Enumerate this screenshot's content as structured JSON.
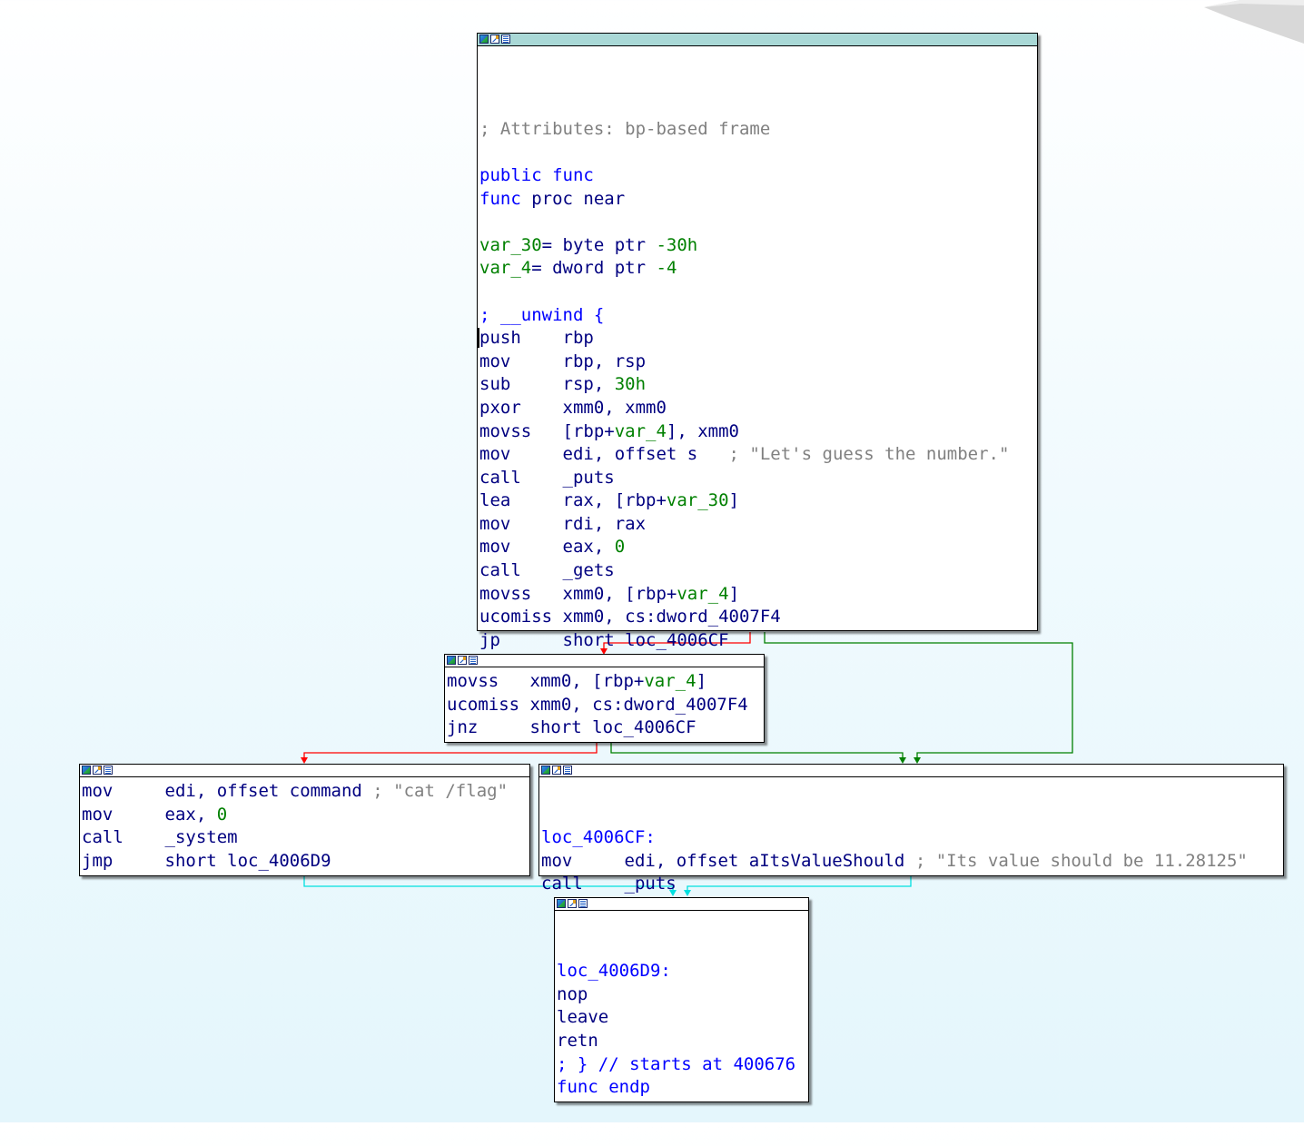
{
  "colors": {
    "edge_false": "#ff0000",
    "edge_true": "#008000",
    "edge_flow": "#00e0e0",
    "titlebar_entry": "#a9d8d6",
    "comment": "#808080",
    "label_blue": "#0000ff",
    "operand_green": "#008000"
  },
  "titlebar_icons": [
    "color-node-icon",
    "graph-overview-icon",
    "text-view-icon"
  ],
  "node_entry": {
    "comment_attrs": "; Attributes: bp-based frame",
    "public_kw": "public",
    "public_name": "func",
    "proc_name": "func",
    "proc_kw": "proc near",
    "var30_name": "var_30",
    "var30_def": "= byte ptr",
    "var30_val": "-30h",
    "var4_name": "var_4",
    "var4_def": "= dword ptr",
    "var4_val": "-4",
    "unwind": "; __unwind {",
    "instructions": [
      {
        "mn": "push",
        "op": "rbp"
      },
      {
        "mn": "mov",
        "op": "rbp, rsp"
      },
      {
        "mn": "sub",
        "op": "rsp, ",
        "op2": "30h"
      },
      {
        "mn": "pxor",
        "op": "xmm0, xmm0"
      },
      {
        "mn": "movss",
        "op": "[rbp+",
        "op2": "var_4",
        "op3": "], xmm0"
      },
      {
        "mn": "mov",
        "op": "edi, offset s",
        "cmt": "; \"Let's guess the number.\""
      },
      {
        "mn": "call",
        "op": "_puts"
      },
      {
        "mn": "lea",
        "op": "rax, [rbp+",
        "op2": "var_30",
        "op3": "]"
      },
      {
        "mn": "mov",
        "op": "rdi, rax"
      },
      {
        "mn": "mov",
        "op": "eax, ",
        "op2": "0"
      },
      {
        "mn": "call",
        "op": "_gets"
      },
      {
        "mn": "movss",
        "op": "xmm0, [rbp+",
        "op2": "var_4",
        "op3": "]"
      },
      {
        "mn": "ucomiss",
        "op": "xmm0, cs:dword_4007F4"
      },
      {
        "mn": "jp",
        "op": "short loc_4006CF"
      }
    ]
  },
  "node_check": {
    "instructions": [
      {
        "mn": "movss",
        "op": "xmm0, [rbp+",
        "op2": "var_4",
        "op3": "]"
      },
      {
        "mn": "ucomiss",
        "op": "xmm0, cs:dword_4007F4"
      },
      {
        "mn": "jnz",
        "op": "short loc_4006CF"
      }
    ]
  },
  "node_system": {
    "instructions": [
      {
        "mn": "mov",
        "op": "edi, offset command",
        "cmt": "; \"cat /flag\""
      },
      {
        "mn": "mov",
        "op": "eax, ",
        "op2": "0"
      },
      {
        "mn": "call",
        "op": "_system"
      },
      {
        "mn": "jmp",
        "op": "short loc_4006D9"
      }
    ]
  },
  "node_fail": {
    "label": "loc_4006CF:",
    "instructions": [
      {
        "mn": "mov",
        "op": "edi, offset aItsValueShould",
        "cmt": "; \"Its value should be 11.28125\""
      },
      {
        "mn": "call",
        "op": "_puts"
      }
    ]
  },
  "node_exit": {
    "label": "loc_4006D9:",
    "lines": [
      "nop",
      "leave",
      "retn"
    ],
    "end_comment": "; } // starts at 400676",
    "endp": "func endp"
  }
}
